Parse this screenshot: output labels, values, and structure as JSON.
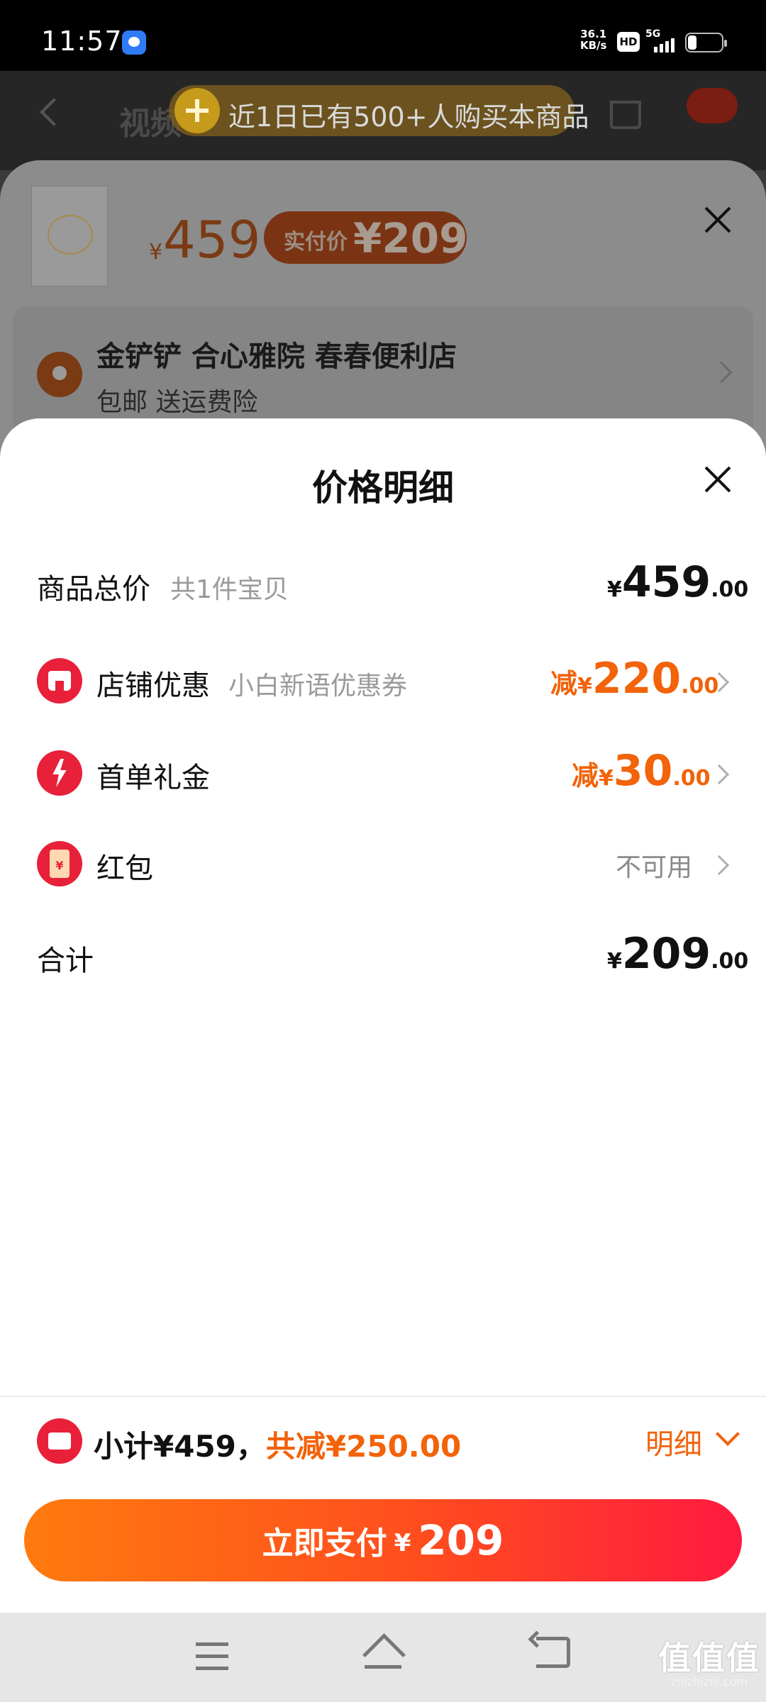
{
  "status_bar": {
    "time": "11:57",
    "speed_value": "36.1",
    "speed_unit": "KB/s",
    "hd": "HD",
    "network": "5G"
  },
  "background": {
    "title_partial": "视频",
    "banner": "近1日已有500+人购买本商品"
  },
  "product_sheet": {
    "price_symbol": "¥",
    "price": "459",
    "pay_label": "实付价",
    "pay_value": "¥209",
    "store": "金铲铲 合心雅院 春春便利店",
    "shipping": "包邮 送运费险"
  },
  "price_detail": {
    "title": "价格明细",
    "rows": [
      {
        "label": "商品总价",
        "sub": "共1件宝贝",
        "prefix": "",
        "symbol": "¥",
        "int": "459",
        "dec": ".00"
      },
      {
        "label": "店铺优惠",
        "sub": "小白新语优惠券",
        "prefix": "减",
        "symbol": "¥",
        "int": "220",
        "dec": ".00",
        "icon": "store-icon"
      },
      {
        "label": "首单礼金",
        "sub": "",
        "prefix": "减",
        "symbol": "¥",
        "int": "30",
        "dec": ".00",
        "icon": "lightning-icon"
      },
      {
        "label": "红包",
        "sub": "",
        "value": "不可用",
        "icon": "red-envelope-icon"
      },
      {
        "label": "合计",
        "sub": "",
        "prefix": "",
        "symbol": "¥",
        "int": "209",
        "dec": ".00"
      }
    ]
  },
  "footer": {
    "subtotal": "小计¥459，",
    "reduction": "共减¥250.00",
    "detail_label": "明细",
    "pay_label": "立即支付",
    "pay_symbol": "¥",
    "pay_value": "209"
  },
  "watermark": {
    "text": "值值值",
    "url": "zhizhizhi.com"
  },
  "colors": {
    "accent": "#f2630a",
    "red": "#e8203a",
    "gradient_start": "#ff7b0e",
    "gradient_end": "#ff1a40"
  }
}
